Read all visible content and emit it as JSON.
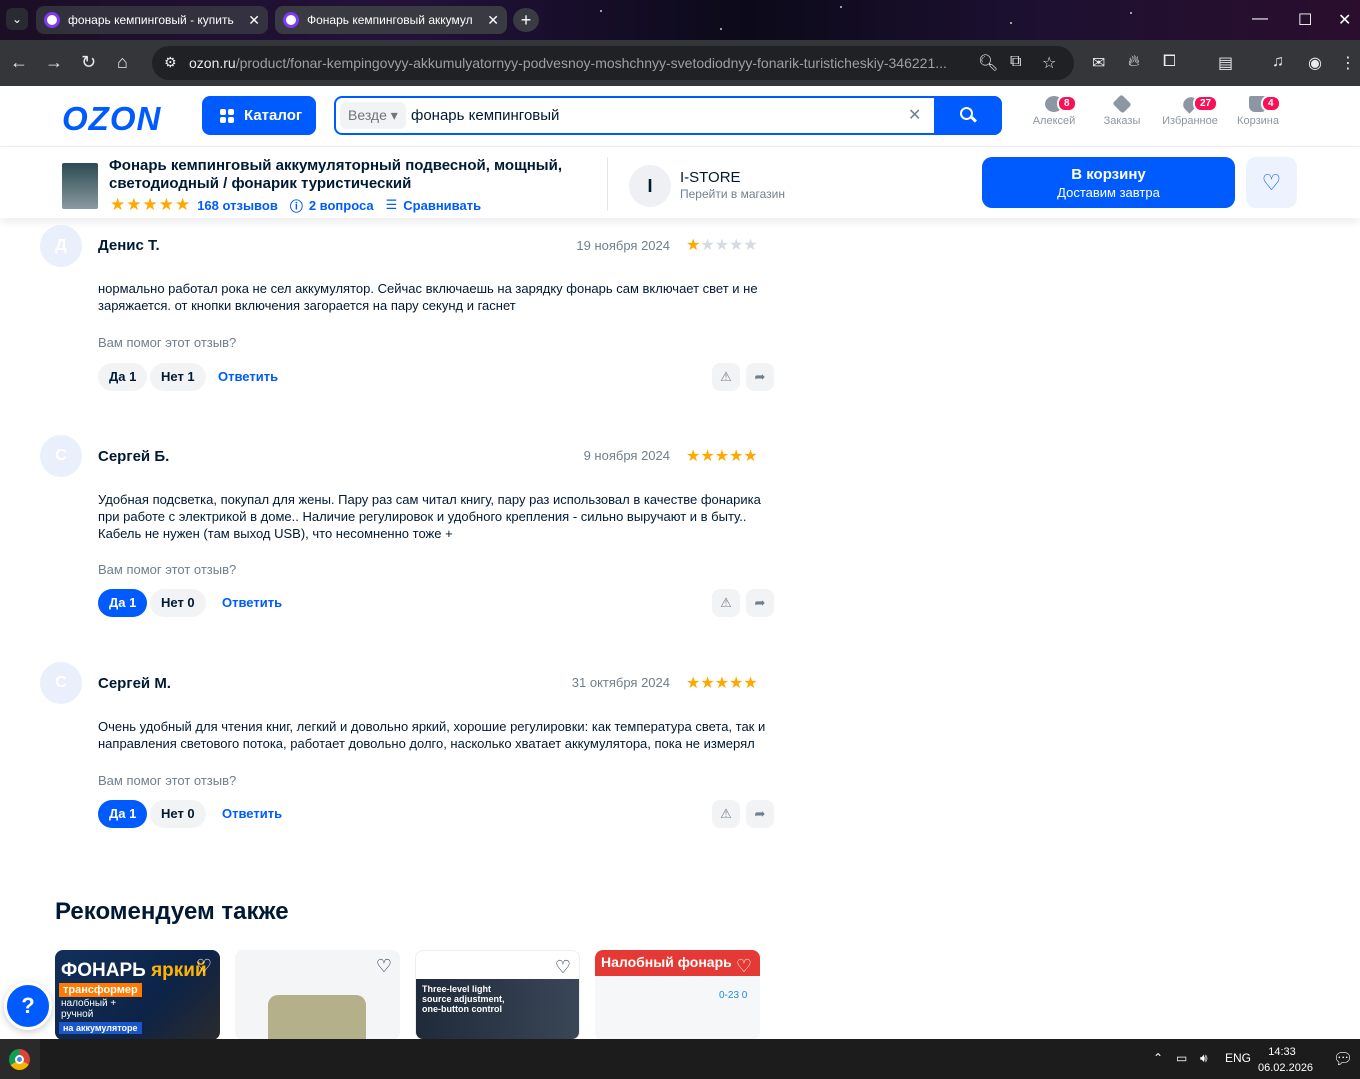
{
  "browser": {
    "tabs": [
      {
        "title": "фонарь кемпинговый - купить"
      },
      {
        "title": "Фонарь кемпинговый аккумул"
      }
    ],
    "url_host": "ozon.ru",
    "url_path": "/product/fonar-kempingovyy-akkumulyatornyy-podvesnoy-moshchnyy-svetodiodnyy-fonarik-turisticheskiy-346221..."
  },
  "header": {
    "logo": "OZON",
    "catalog_label": "Каталог",
    "search_scope": "Везде",
    "search_query": "фонарь кемпинговый",
    "icons": [
      {
        "label": "Алексей",
        "badge": "8",
        "icon": "user-icon"
      },
      {
        "label": "Заказы",
        "badge": "",
        "icon": "box-icon"
      },
      {
        "label": "Избранное",
        "badge": "27",
        "icon": "heart-icon"
      },
      {
        "label": "Корзина",
        "badge": "4",
        "icon": "cart-icon"
      }
    ]
  },
  "product": {
    "title": "Фонарь кемпинговый аккумуляторный подвесной, мощный, светодиодный / фонарик туристический",
    "reviews_count": "168 отзывов",
    "questions": "2 вопроса",
    "compare": "Сравнивать",
    "rating": 5,
    "store_initial": "I",
    "store_name": "I-STORE",
    "store_link": "Перейти в магазин",
    "cart_label": "В корзину",
    "cart_sub": "Доставим завтра"
  },
  "reviews": [
    {
      "initial": "Д",
      "author": "Денис Т.",
      "date": "19 ноября 2024",
      "rating": 1,
      "text": "нормально работал рока не сел аккумулятор. Сейчас включаешь на зарядку фонарь сам включает свет и не заряжается. от кнопки включения загорается на пару секунд и гаснет",
      "question": "Вам помог этот отзыв?",
      "yes": "Да 1",
      "no": "Нет 1",
      "yes_selected": false,
      "reply": "Ответить"
    },
    {
      "initial": "С",
      "author": "Сергей Б.",
      "date": "9 ноября 2024",
      "rating": 5,
      "text": "Удобная подсветка, покупал для жены. Пару раз сам читал книгу, пару раз использовал в качестве фонарика при работе с электрикой в доме.. Наличие регулировок и удобного крепления - сильно выручают и в быту.. Кабель не нужен (там выход USB), что несомненно тоже +",
      "question": "Вам помог этот отзыв?",
      "yes": "Да 1",
      "no": "Нет 0",
      "yes_selected": true,
      "reply": "Ответить"
    },
    {
      "initial": "С",
      "author": "Сергей М.",
      "date": "31 октября 2024",
      "rating": 5,
      "text": "Очень удобный для чтения книг, легкий и довольно яркий, хорошие регулировки: как температура света, так и направления светового потока, работает довольно долго, насколько хватает аккумулятора, пока не измерял",
      "question": "Вам помог этот отзыв?",
      "yes": "Да 1",
      "no": "Нет 0",
      "yes_selected": true,
      "reply": "Ответить"
    }
  ],
  "recommend": {
    "title": "Рекомендуем также",
    "cards": [
      {
        "line1": "ФОНАРЬ",
        "line1b": "яркий",
        "line2": "трансформер",
        "line3": "налобный + ручной",
        "line4": "на аккумуляторе"
      },
      {},
      {
        "text": "Three-level light source adjustment, one-button control"
      },
      {
        "banner": "Налобный фонарь",
        "dim": "0-23 0"
      }
    ]
  },
  "help_label": "?",
  "taskbar": {
    "lang": "ENG",
    "time": "14:33",
    "date": "06.02.2026"
  },
  "colors": {
    "brand": "#005bff",
    "star": "#ffa800",
    "badge": "#f91155"
  }
}
